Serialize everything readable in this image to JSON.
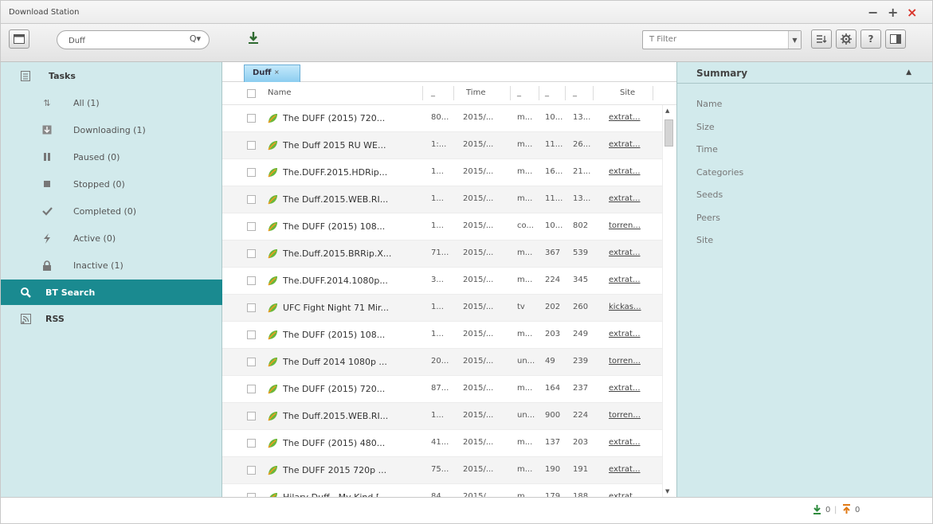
{
  "app": {
    "title": "Download Station",
    "window_controls": {
      "minimize": "−",
      "maximize": "+",
      "close": "×"
    }
  },
  "toolbar": {
    "search_value": "Duff",
    "search_icon": "Q▾",
    "filter_placeholder": "Filter",
    "filter_icon": "T"
  },
  "sidebar": {
    "tasks_label": "Tasks",
    "items": [
      {
        "label": "All (1)",
        "icon": "all-tasks-icon"
      },
      {
        "label": "Downloading (1)",
        "icon": "downloading-icon"
      },
      {
        "label": "Paused (0)",
        "icon": "pause-icon"
      },
      {
        "label": "Stopped (0)",
        "icon": "stop-icon"
      },
      {
        "label": "Completed (0)",
        "icon": "check-icon"
      },
      {
        "label": "Active (0)",
        "icon": "active-icon"
      },
      {
        "label": "Inactive (1)",
        "icon": "inactive-icon"
      }
    ],
    "bt_search_label": "BT Search",
    "rss_label": "RSS"
  },
  "main": {
    "tab_label": "Duff",
    "tab_close": "×",
    "columns": {
      "name": "Name",
      "col2": "_",
      "time": "Time",
      "col4": "_",
      "col5": "_",
      "col6": "_",
      "site": "Site"
    },
    "rows": [
      {
        "name": "The DUFF (2015) 720...",
        "size": "80...",
        "time": "2015/...",
        "cat": "m...",
        "seeds": "10...",
        "peers": "13...",
        "site": "extrat..."
      },
      {
        "name": "The Duff 2015 RU WE...",
        "size": "1:...",
        "time": "2015/...",
        "cat": "m...",
        "seeds": "11...",
        "peers": "26...",
        "site": "extrat..."
      },
      {
        "name": "The.DUFF.2015.HDRip...",
        "size": "1...",
        "time": "2015/...",
        "cat": "m...",
        "seeds": "16...",
        "peers": "21...",
        "site": "extrat..."
      },
      {
        "name": "The Duff.2015.WEB.RI...",
        "size": "1...",
        "time": "2015/...",
        "cat": "m...",
        "seeds": "11...",
        "peers": "13...",
        "site": "extrat..."
      },
      {
        "name": "The DUFF (2015) 108...",
        "size": "1...",
        "time": "2015/...",
        "cat": "co...",
        "seeds": "10...",
        "peers": "802",
        "site": "torren..."
      },
      {
        "name": "The.Duff.2015.BRRip.X...",
        "size": "71...",
        "time": "2015/...",
        "cat": "m...",
        "seeds": "367",
        "peers": "539",
        "site": "extrat..."
      },
      {
        "name": "The.DUFF.2014.1080p...",
        "size": "3...",
        "time": "2015/...",
        "cat": "m...",
        "seeds": "224",
        "peers": "345",
        "site": "extrat..."
      },
      {
        "name": "UFC Fight Night 71 Mir...",
        "size": "1...",
        "time": "2015/...",
        "cat": "tv",
        "seeds": "202",
        "peers": "260",
        "site": "kickas..."
      },
      {
        "name": "The DUFF (2015) 108...",
        "size": "1...",
        "time": "2015/...",
        "cat": "m...",
        "seeds": "203",
        "peers": "249",
        "site": "extrat..."
      },
      {
        "name": "The Duff 2014 1080p ...",
        "size": "20...",
        "time": "2015/...",
        "cat": "un...",
        "seeds": "49",
        "peers": "239",
        "site": "torren..."
      },
      {
        "name": "The DUFF (2015) 720...",
        "size": "87...",
        "time": "2015/...",
        "cat": "m...",
        "seeds": "164",
        "peers": "237",
        "site": "extrat..."
      },
      {
        "name": "The Duff.2015.WEB.RI...",
        "size": "1...",
        "time": "2015/...",
        "cat": "un...",
        "seeds": "900",
        "peers": "224",
        "site": "torren..."
      },
      {
        "name": "The DUFF (2015) 480...",
        "size": "41...",
        "time": "2015/...",
        "cat": "m...",
        "seeds": "137",
        "peers": "203",
        "site": "extrat..."
      },
      {
        "name": "The DUFF 2015 720p ...",
        "size": "75...",
        "time": "2015/...",
        "cat": "m...",
        "seeds": "190",
        "peers": "191",
        "site": "extrat..."
      },
      {
        "name": "Hilary Duff - My Kind [...",
        "size": "84...",
        "time": "2015/...",
        "cat": "m...",
        "seeds": "179",
        "peers": "188",
        "site": "extrat..."
      }
    ]
  },
  "summary": {
    "title": "Summary",
    "toggle": "▲",
    "fields": [
      "Name",
      "Size",
      "Time",
      "Categories",
      "Seeds",
      "Peers",
      "Site"
    ]
  },
  "status": {
    "download_count": "0",
    "separator": "|",
    "upload_count": "0"
  },
  "colors": {
    "sidebar_bg": "#d2eaec",
    "selected_bg": "#1a8a90",
    "accent_close": "#d9342b",
    "download_green": "#2e8b3d",
    "upload_orange": "#e07a16"
  }
}
